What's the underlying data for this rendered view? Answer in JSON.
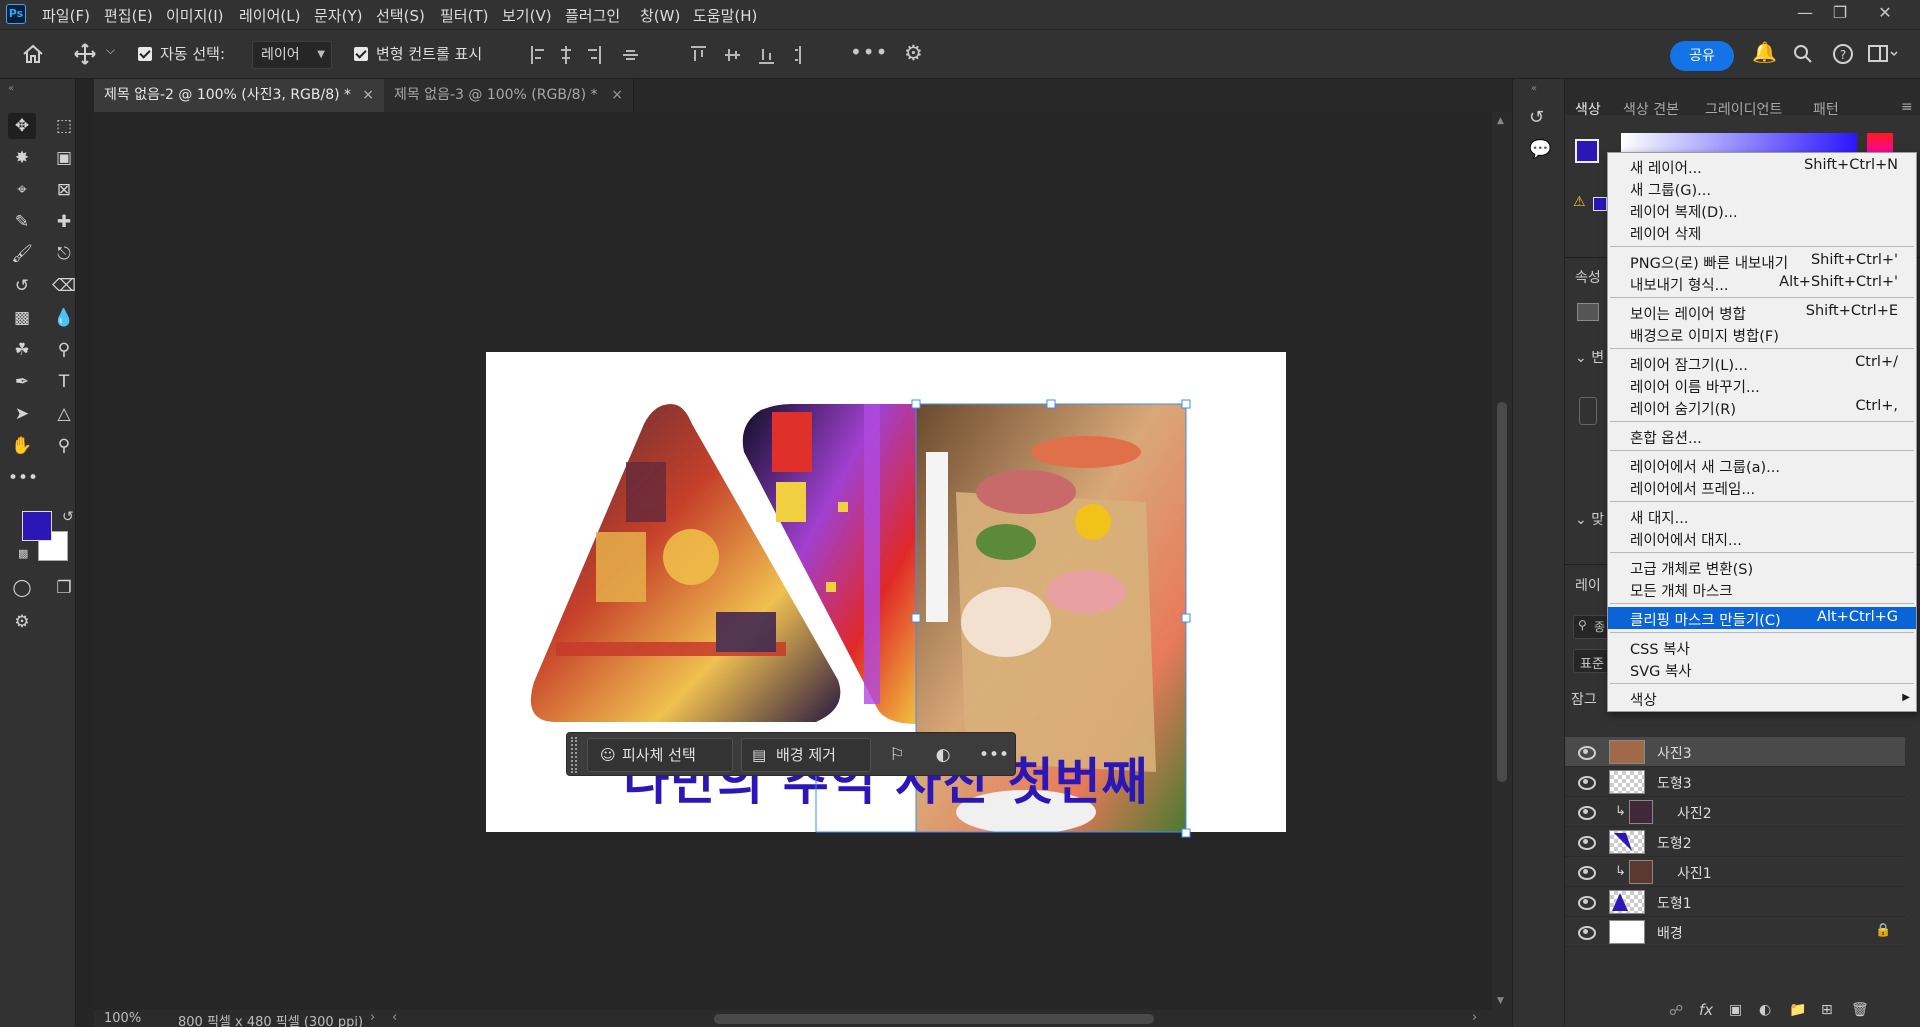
{
  "app": {
    "logo": "Ps",
    "menu": [
      "파일(F)",
      "편집(E)",
      "이미지(I)",
      "레이어(L)",
      "문자(Y)",
      "선택(S)",
      "필터(T)",
      "보기(V)",
      "플러그인",
      "창(W)",
      "도움말(H)"
    ]
  },
  "options_bar": {
    "auto_select_label": "자동 선택:",
    "auto_select_value": "레이어",
    "transform_controls_label": "변형 컨트롤 표시",
    "share_label": "공유"
  },
  "tabs": [
    {
      "label": "제목 없음-2 @ 100% (사진3, RGB/8) *",
      "active": true
    },
    {
      "label": "제목 없음-3 @ 100% (RGB/8) *",
      "active": false
    }
  ],
  "canvas": {
    "title_text": "나만의 추억 사진 첫번째",
    "title_color": "#2b17b5",
    "panels": [
      {
        "name": "city-street-photo",
        "colors": [
          "#4a2a38",
          "#c6402a",
          "#f0c050",
          "#2a1a40"
        ]
      },
      {
        "name": "tower-night-photo",
        "colors": [
          "#0e0e26",
          "#a040d0",
          "#e02828",
          "#f0c040"
        ]
      },
      {
        "name": "sashimi-plate-photo",
        "colors": [
          "#6a4a2e",
          "#d9a878",
          "#e87a5a",
          "#4a7a30"
        ]
      }
    ]
  },
  "context_taskbar": {
    "select_subject": "피사체 선택",
    "remove_background": "배경 제거"
  },
  "status": {
    "zoom": "100%",
    "doc_size": "800 픽셀 x 480 픽셀 (300 ppi)"
  },
  "panels": {
    "color_tabs": [
      "색상",
      "색상 견본",
      "그레이디언트",
      "패턴"
    ],
    "properties_label": "속성",
    "transform_label": "변",
    "align_label": "맞",
    "layers_label": "레이",
    "search_label": "종",
    "blend_label": "표준",
    "lock_label": "잠그",
    "foreground_color": "#2b17b5"
  },
  "layers": [
    {
      "name": "사진3",
      "selected": true,
      "clipped": false,
      "kind": "photo"
    },
    {
      "name": "도형3",
      "selected": false,
      "clipped": false,
      "kind": "shape"
    },
    {
      "name": "사진2",
      "selected": false,
      "clipped": true,
      "kind": "photo"
    },
    {
      "name": "도형2",
      "selected": false,
      "clipped": false,
      "kind": "shape"
    },
    {
      "name": "사진1",
      "selected": false,
      "clipped": true,
      "kind": "photo"
    },
    {
      "name": "도형1",
      "selected": false,
      "clipped": false,
      "kind": "shape"
    },
    {
      "name": "배경",
      "selected": false,
      "clipped": false,
      "kind": "background"
    }
  ],
  "context_menu": [
    {
      "label": "새 레이어...",
      "shortcut": "Shift+Ctrl+N"
    },
    {
      "label": "새 그룹(G)...",
      "shortcut": ""
    },
    {
      "label": "레이어 복제(D)...",
      "shortcut": ""
    },
    {
      "label": "레이어 삭제",
      "shortcut": ""
    },
    {
      "separator": true
    },
    {
      "label": "PNG으(로) 빠른 내보내기",
      "shortcut": "Shift+Ctrl+'"
    },
    {
      "label": "내보내기 형식...",
      "shortcut": "Alt+Shift+Ctrl+'"
    },
    {
      "separator": true
    },
    {
      "label": "보이는 레이어 병합",
      "shortcut": "Shift+Ctrl+E"
    },
    {
      "label": "배경으로 이미지 병합(F)",
      "shortcut": ""
    },
    {
      "separator": true
    },
    {
      "label": "레이어 잠그기(L)...",
      "shortcut": "Ctrl+/"
    },
    {
      "label": "레이어 이름 바꾸기...",
      "shortcut": ""
    },
    {
      "label": "레이어 숨기기(R)",
      "shortcut": "Ctrl+,"
    },
    {
      "separator": true
    },
    {
      "label": "혼합 옵션...",
      "shortcut": ""
    },
    {
      "separator": true
    },
    {
      "label": "레이어에서 새 그룹(a)...",
      "shortcut": ""
    },
    {
      "label": "레이어에서 프레임...",
      "shortcut": ""
    },
    {
      "separator": true
    },
    {
      "label": "새 대지...",
      "shortcut": ""
    },
    {
      "label": "레이어에서 대지...",
      "shortcut": ""
    },
    {
      "separator": true
    },
    {
      "label": "고급 개체로 변환(S)",
      "shortcut": ""
    },
    {
      "label": "모든 개체 마스크",
      "shortcut": ""
    },
    {
      "separator": true
    },
    {
      "label": "클리핑 마스크 만들기(C)",
      "shortcut": "Alt+Ctrl+G",
      "highlighted": true
    },
    {
      "separator": true
    },
    {
      "label": "CSS 복사",
      "shortcut": ""
    },
    {
      "label": "SVG 복사",
      "shortcut": ""
    },
    {
      "separator": true
    },
    {
      "label": "색상",
      "shortcut": "",
      "submenu": true
    }
  ]
}
